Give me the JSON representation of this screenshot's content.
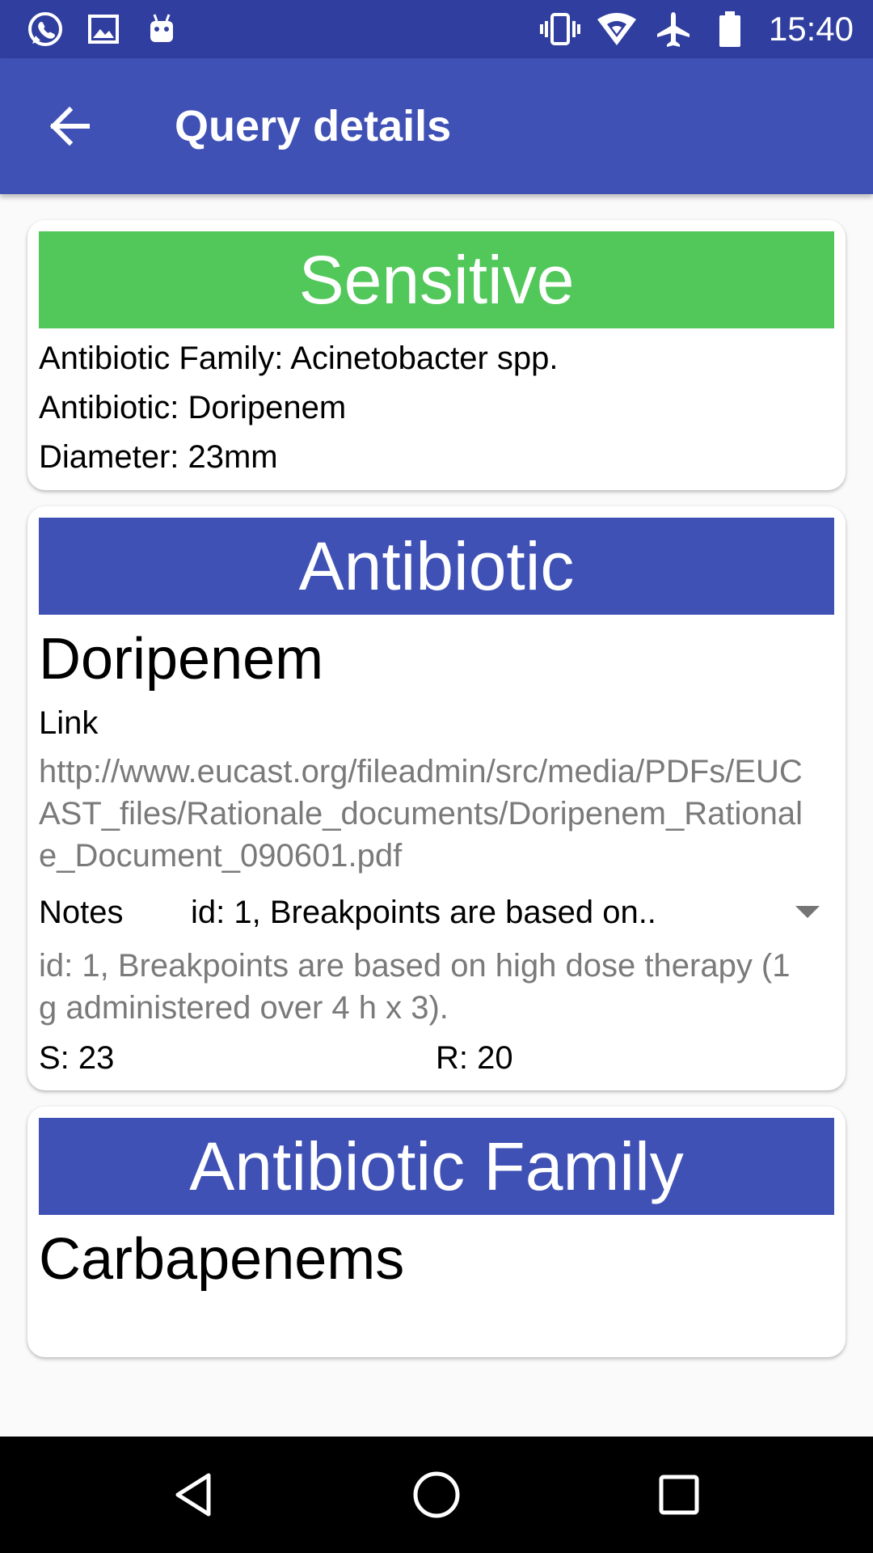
{
  "status_bar": {
    "time": "15:40",
    "left_icons": [
      "whatsapp-icon",
      "gallery-icon",
      "android-debug-icon"
    ],
    "right_icons": [
      "vibrate-icon",
      "wifi-icon",
      "airplane-icon",
      "battery-icon"
    ]
  },
  "app_bar": {
    "title": "Query details",
    "back_icon": "arrow-back-icon"
  },
  "result_card": {
    "banner": "Sensitive",
    "banner_color": "#52c75a",
    "family_line": "Antibiotic Family: Acinetobacter spp.",
    "antibiotic_line": "Antibiotic: Doripenem",
    "diameter_line": "Diameter: 23mm"
  },
  "antibiotic_card": {
    "banner": "Antibiotic",
    "banner_color": "#3f51b5",
    "name": "Doripenem",
    "link_label": "Link",
    "link_url": "http://www.eucast.org/fileadmin/src/media/PDFs/EUCAST_files/Rationale_documents/Doripenem_Rationale_Document_090601.pdf",
    "notes_label": "Notes",
    "notes_selected": "id: 1,  Breakpoints are based on..",
    "notes_text": "id: 1,  Breakpoints are based on high dose therapy (1 g administered over 4 h x 3).",
    "s_value": "S: 23",
    "r_value": "R: 20"
  },
  "family_card": {
    "banner": "Antibiotic Family",
    "name": "Carbapenems"
  },
  "nav_bar": {
    "buttons": [
      "back-triangle-icon",
      "home-circle-icon",
      "recents-square-icon"
    ]
  },
  "colors": {
    "status_bar": "#303f9f",
    "primary": "#3f51b5",
    "sensitive": "#52c75a"
  }
}
